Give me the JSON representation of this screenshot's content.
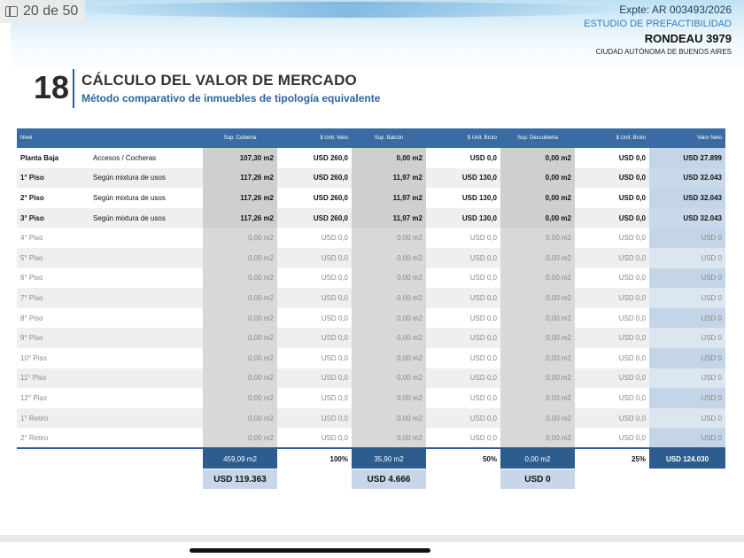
{
  "viewer": {
    "page_counter": "20 de 50",
    "sidebar_icon": "sidebar-icon"
  },
  "header": {
    "expte": "Expte: AR 003493/2026",
    "estudio": "ESTUDIO DE PREFACTIBILIDAD",
    "address": "RONDEAU 3979",
    "city": "CIUDAD AUTÓNOMA DE BUENOS AIRES"
  },
  "section": {
    "number": "18",
    "title": "CÁLCULO DEL VALOR DE MERCADO",
    "subtitle": "Método comparativo de inmuebles de tipología equivalente"
  },
  "table": {
    "headers": [
      "Nivel",
      "",
      "Sup. Cubierta",
      "$ Unit. Neto",
      "Sup. Balcón",
      "$ Unit. Bruto",
      "Sup. Descubierta",
      "$ Unit. Bruto",
      "Valor Neto"
    ],
    "rows": [
      {
        "active": true,
        "cells": [
          "Planta Baja",
          "Accesos / Cocheras",
          "107,30 m2",
          "USD  260,0",
          "0,00 m2",
          "USD  0,0",
          "0,00 m2",
          "USD  0,0",
          "USD  27.899"
        ]
      },
      {
        "active": true,
        "cells": [
          "1° Piso",
          "Según mixtura de usos",
          "117,26 m2",
          "USD  260,0",
          "11,97 m2",
          "USD  130,0",
          "0,00 m2",
          "USD  0,0",
          "USD  32.043"
        ]
      },
      {
        "active": true,
        "cells": [
          "2° Piso",
          "Según mixtura de usos",
          "117,26 m2",
          "USD  260,0",
          "11,97 m2",
          "USD  130,0",
          "0,00 m2",
          "USD  0,0",
          "USD  32.043"
        ]
      },
      {
        "active": true,
        "cells": [
          "3° Piso",
          "Según mixtura de usos",
          "117,26 m2",
          "USD  260,0",
          "11,97 m2",
          "USD  130,0",
          "0,00 m2",
          "USD  0,0",
          "USD  32.043"
        ]
      },
      {
        "active": false,
        "cells": [
          "4° Piso",
          "",
          "0,00 m2",
          "USD  0,0",
          "0,00 m2",
          "USD  0,0",
          "0,00 m2",
          "USD  0,0",
          "USD    0"
        ]
      },
      {
        "active": false,
        "cells": [
          "5° Piso",
          "",
          "0,00 m2",
          "USD  0,0",
          "0,00 m2",
          "USD  0,0",
          "0,00 m2",
          "USD  0,0",
          "USD    0"
        ]
      },
      {
        "active": false,
        "cells": [
          "6° Piso",
          "",
          "0,00 m2",
          "USD  0,0",
          "0,00 m2",
          "USD  0,0",
          "0,00 m2",
          "USD  0,0",
          "USD    0"
        ]
      },
      {
        "active": false,
        "cells": [
          "7° Piso",
          "",
          "0,00 m2",
          "USD  0,0",
          "0,00 m2",
          "USD  0,0",
          "0,00 m2",
          "USD  0,0",
          "USD    0"
        ]
      },
      {
        "active": false,
        "cells": [
          "8° Piso",
          "",
          "0,00 m2",
          "USD  0,0",
          "0,00 m2",
          "USD  0,0",
          "0,00 m2",
          "USD  0,0",
          "USD    0"
        ]
      },
      {
        "active": false,
        "cells": [
          "9° Piso",
          "",
          "0,00 m2",
          "USD  0,0",
          "0,00 m2",
          "USD  0,0",
          "0,00 m2",
          "USD  0,0",
          "USD    0"
        ]
      },
      {
        "active": false,
        "cells": [
          "10° Piso",
          "",
          "0,00 m2",
          "USD  0,0",
          "0,00 m2",
          "USD  0,0",
          "0,00 m2",
          "USD  0,0",
          "USD    0"
        ]
      },
      {
        "active": false,
        "cells": [
          "11° Piso",
          "",
          "0,00 m2",
          "USD  0,0",
          "0,00 m2",
          "USD  0,0",
          "0,00 m2",
          "USD  0,0",
          "USD    0"
        ]
      },
      {
        "active": false,
        "cells": [
          "12° Piso",
          "",
          "0,00 m2",
          "USD  0,0",
          "0,00 m2",
          "USD  0,0",
          "0,00 m2",
          "USD  0,0",
          "USD    0"
        ]
      },
      {
        "active": false,
        "cells": [
          "1° Retiro",
          "",
          "0,00 m2",
          "USD  0,0",
          "0,00 m2",
          "USD  0,0",
          "0,00 m2",
          "USD  0,0",
          "USD    0"
        ]
      },
      {
        "active": false,
        "cells": [
          "2° Retiro",
          "",
          "0,00 m2",
          "USD  0,0",
          "0,00 m2",
          "USD  0,0",
          "0,00 m2",
          "USD  0,0",
          "USD    0"
        ]
      }
    ],
    "totals": {
      "sup_cubierta": "459,09 m2",
      "pct_neto": "100%",
      "sup_balcon": "35,90 m2",
      "pct_balcon": "50%",
      "sup_descubierta": "0,00 m2",
      "pct_descubierta": "25%",
      "valor_total": "USD 124.030",
      "subtotal_cubierta": "USD  119.363",
      "subtotal_balcon": "USD  4.666",
      "subtotal_descubierta": "USD  0"
    }
  }
}
